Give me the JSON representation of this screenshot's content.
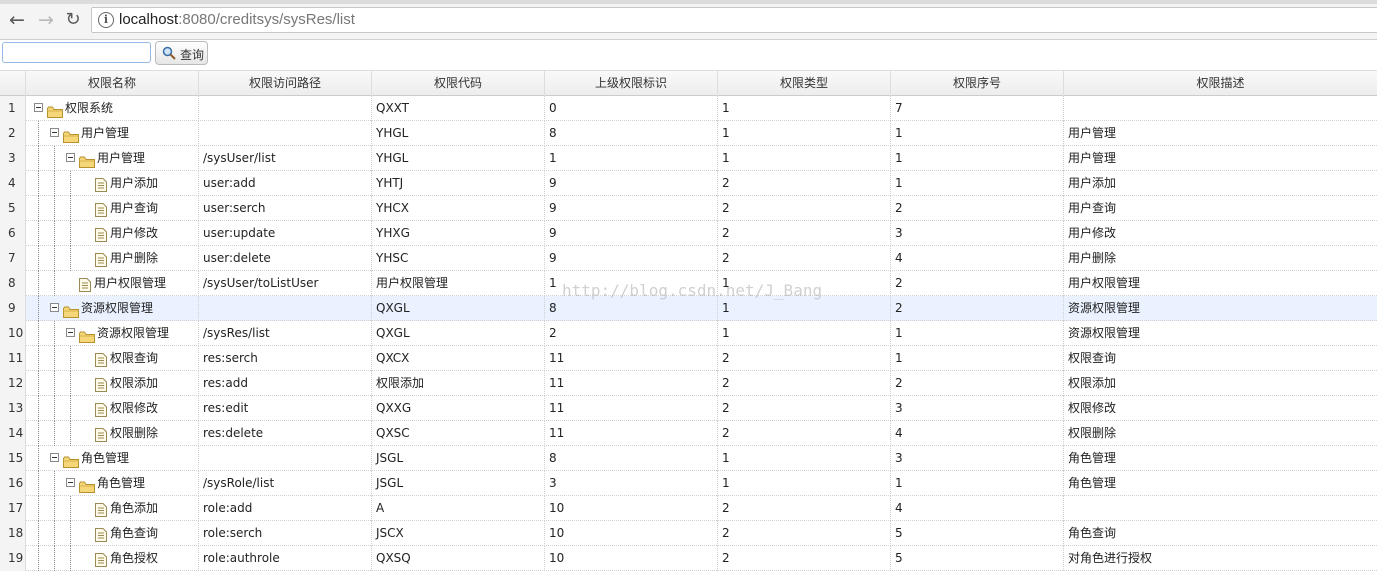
{
  "browser": {
    "url_host": "localhost",
    "url_rest": ":8080/creditsys/sysRes/list",
    "icons": {
      "back": "arrow-left-icon",
      "forward": "arrow-right-icon",
      "reload": "reload-icon",
      "info": "info-icon"
    }
  },
  "search": {
    "input_value": "",
    "button_label": "查询",
    "icon": "search-icon"
  },
  "grid": {
    "columns": [
      "权限名称",
      "权限访问路径",
      "权限代码",
      "上级权限标识",
      "权限类型",
      "权限序号",
      "权限描述"
    ],
    "rows": [
      {
        "num": "1",
        "depth": 0,
        "node": "folder",
        "toggle": true,
        "name": "权限系统",
        "path": "",
        "code": "QXXT",
        "parent": "0",
        "type": "1",
        "seq": "7",
        "desc": ""
      },
      {
        "num": "2",
        "depth": 1,
        "node": "folder",
        "toggle": true,
        "name": "用户管理",
        "path": "",
        "code": "YHGL",
        "parent": "8",
        "type": "1",
        "seq": "1",
        "desc": "用户管理"
      },
      {
        "num": "3",
        "depth": 2,
        "node": "folder",
        "toggle": true,
        "name": "用户管理",
        "path": "/sysUser/list",
        "code": "YHGL",
        "parent": "1",
        "type": "1",
        "seq": "1",
        "desc": "用户管理"
      },
      {
        "num": "4",
        "depth": 3,
        "node": "file",
        "toggle": false,
        "name": "用户添加",
        "path": "user:add",
        "code": "YHTJ",
        "parent": "9",
        "type": "2",
        "seq": "1",
        "desc": "用户添加"
      },
      {
        "num": "5",
        "depth": 3,
        "node": "file",
        "toggle": false,
        "name": "用户查询",
        "path": "user:serch",
        "code": "YHCX",
        "parent": "9",
        "type": "2",
        "seq": "2",
        "desc": "用户查询"
      },
      {
        "num": "6",
        "depth": 3,
        "node": "file",
        "toggle": false,
        "name": "用户修改",
        "path": "user:update",
        "code": "YHXG",
        "parent": "9",
        "type": "2",
        "seq": "3",
        "desc": "用户修改"
      },
      {
        "num": "7",
        "depth": 3,
        "node": "file",
        "toggle": false,
        "name": "用户删除",
        "path": "user:delete",
        "code": "YHSC",
        "parent": "9",
        "type": "2",
        "seq": "4",
        "desc": "用户删除"
      },
      {
        "num": "8",
        "depth": 2,
        "node": "file",
        "toggle": false,
        "name": "用户权限管理",
        "path": "/sysUser/toListUser",
        "code": "用户权限管理",
        "parent": "1",
        "type": "1",
        "seq": "2",
        "desc": "用户权限管理"
      },
      {
        "num": "9",
        "depth": 1,
        "node": "folder",
        "toggle": true,
        "name": "资源权限管理",
        "path": "",
        "code": "QXGL",
        "parent": "8",
        "type": "1",
        "seq": "2",
        "desc": "资源权限管理",
        "selected": true
      },
      {
        "num": "10",
        "depth": 2,
        "node": "folder",
        "toggle": true,
        "name": "资源权限管理",
        "path": "/sysRes/list",
        "code": "QXGL",
        "parent": "2",
        "type": "1",
        "seq": "1",
        "desc": "资源权限管理"
      },
      {
        "num": "11",
        "depth": 3,
        "node": "file",
        "toggle": false,
        "name": "权限查询",
        "path": "res:serch",
        "code": "QXCX",
        "parent": "11",
        "type": "2",
        "seq": "1",
        "desc": "权限查询"
      },
      {
        "num": "12",
        "depth": 3,
        "node": "file",
        "toggle": false,
        "name": "权限添加",
        "path": "res:add",
        "code": "权限添加",
        "parent": "11",
        "type": "2",
        "seq": "2",
        "desc": "权限添加"
      },
      {
        "num": "13",
        "depth": 3,
        "node": "file",
        "toggle": false,
        "name": "权限修改",
        "path": "res:edit",
        "code": "QXXG",
        "parent": "11",
        "type": "2",
        "seq": "3",
        "desc": "权限修改"
      },
      {
        "num": "14",
        "depth": 3,
        "node": "file",
        "toggle": false,
        "name": "权限删除",
        "path": "res:delete",
        "code": "QXSC",
        "parent": "11",
        "type": "2",
        "seq": "4",
        "desc": "权限删除"
      },
      {
        "num": "15",
        "depth": 1,
        "node": "folder",
        "toggle": true,
        "name": "角色管理",
        "path": "",
        "code": "JSGL",
        "parent": "8",
        "type": "1",
        "seq": "3",
        "desc": "角色管理"
      },
      {
        "num": "16",
        "depth": 2,
        "node": "folder",
        "toggle": true,
        "name": "角色管理",
        "path": "/sysRole/list",
        "code": "JSGL",
        "parent": "3",
        "type": "1",
        "seq": "1",
        "desc": "角色管理"
      },
      {
        "num": "17",
        "depth": 3,
        "node": "file",
        "toggle": false,
        "name": "角色添加",
        "path": "role:add",
        "code": "A",
        "parent": "10",
        "type": "2",
        "seq": "4",
        "desc": ""
      },
      {
        "num": "18",
        "depth": 3,
        "node": "file",
        "toggle": false,
        "name": "角色查询",
        "path": "role:serch",
        "code": "JSCX",
        "parent": "10",
        "type": "2",
        "seq": "5",
        "desc": "角色查询"
      },
      {
        "num": "19",
        "depth": 3,
        "node": "file",
        "toggle": false,
        "name": "角色授权",
        "path": "role:authrole",
        "code": "QXSQ",
        "parent": "10",
        "type": "2",
        "seq": "5",
        "desc": "对角色进行授权"
      }
    ]
  },
  "watermark": "http://blog.csdn.net/J_Bang",
  "colors": {
    "selected_row": "#eaf2ff",
    "folder": "#f5d77a",
    "input_border": "#95b8e7"
  }
}
